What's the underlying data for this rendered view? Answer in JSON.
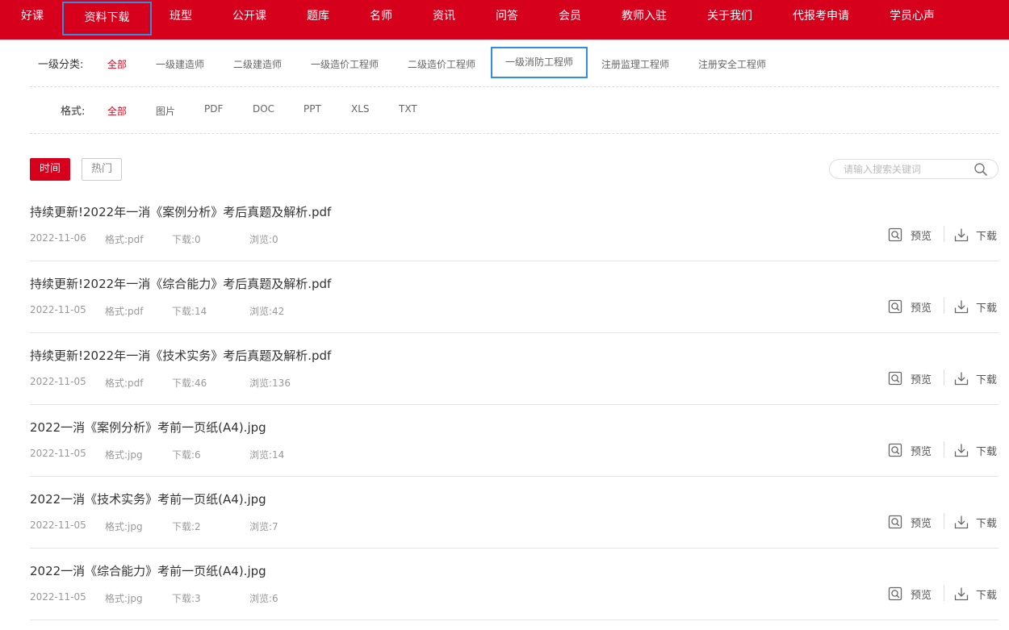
{
  "nav": {
    "items": [
      {
        "label": "好课"
      },
      {
        "label": "资料下载"
      },
      {
        "label": "班型"
      },
      {
        "label": "公开课"
      },
      {
        "label": "题库"
      },
      {
        "label": "名师"
      },
      {
        "label": "资讯"
      },
      {
        "label": "问答"
      },
      {
        "label": "会员"
      },
      {
        "label": "教师入驻"
      },
      {
        "label": "关于我们"
      },
      {
        "label": "代报考申请"
      },
      {
        "label": "学员心声"
      }
    ],
    "active_index": 1
  },
  "filters": {
    "category": {
      "label": "一级分类:",
      "options": [
        "全部",
        "一级建造师",
        "二级建造师",
        "一级造价工程师",
        "二级造价工程师",
        "一级消防工程师",
        "注册监理工程师",
        "注册安全工程师"
      ]
    },
    "format": {
      "label": "格式:",
      "options": [
        "全部",
        "图片",
        "PDF",
        "DOC",
        "PPT",
        "XLS",
        "TXT"
      ]
    }
  },
  "sort": {
    "time": "时间",
    "hot": "热门"
  },
  "search": {
    "placeholder": "请输入搜索关键词",
    "value": ""
  },
  "actions": {
    "preview": "预览",
    "download": "下载"
  },
  "files": [
    {
      "title": "持续更新!2022年一消《案例分析》考后真题及解析.pdf",
      "date": "2022-11-06",
      "format": "格式:pdf",
      "downloads": "下载:0",
      "views": "浏览:0"
    },
    {
      "title": "持续更新!2022年一消《综合能力》考后真题及解析.pdf",
      "date": "2022-11-05",
      "format": "格式:pdf",
      "downloads": "下载:14",
      "views": "浏览:42"
    },
    {
      "title": "持续更新!2022年一消《技术实务》考后真题及解析.pdf",
      "date": "2022-11-05",
      "format": "格式:pdf",
      "downloads": "下载:46",
      "views": "浏览:136"
    },
    {
      "title": "2022一消《案例分析》考前一页纸(A4).jpg",
      "date": "2022-11-05",
      "format": "格式:jpg",
      "downloads": "下载:6",
      "views": "浏览:14"
    },
    {
      "title": "2022一消《技术实务》考前一页纸(A4).jpg",
      "date": "2022-11-05",
      "format": "格式:jpg",
      "downloads": "下载:2",
      "views": "浏览:7"
    },
    {
      "title": "2022一消《综合能力》考前一页纸(A4).jpg",
      "date": "2022-11-05",
      "format": "格式:jpg",
      "downloads": "下载:3",
      "views": "浏览:6"
    }
  ],
  "colors": {
    "brand": "#d6001c",
    "highlight_border": "#2f8fe0"
  }
}
